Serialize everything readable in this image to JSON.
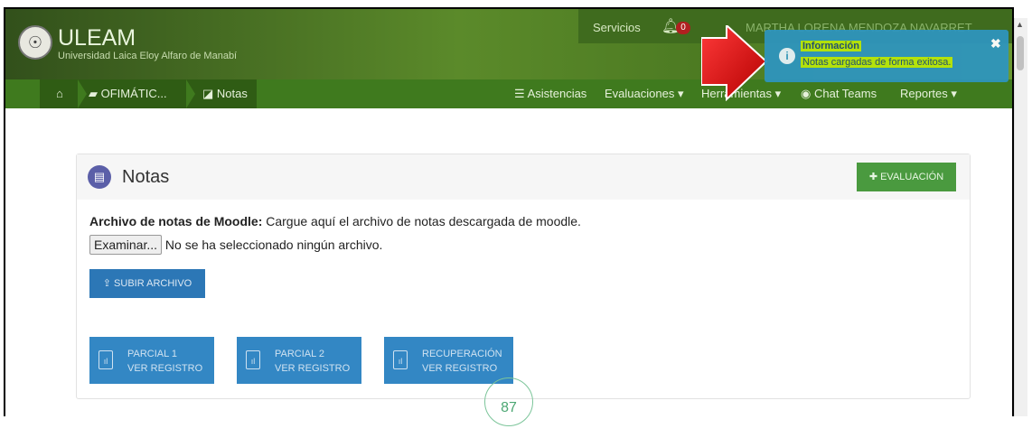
{
  "brand": {
    "title": "ULEAM",
    "subtitle": "Universidad Laica Eloy Alfaro de Manabí"
  },
  "top_bar": {
    "services": "Servicios",
    "notifications_count": "0",
    "user_name": "MARTHA LORENA MENDOZA NAVARRET"
  },
  "breadcrumb": {
    "course": "OFIMÁTIC...",
    "current": "Notas"
  },
  "nav": {
    "asistencias": "Asistencias",
    "evaluaciones": "Evaluaciones",
    "herramientas": "Herramientas",
    "chat": "Chat Teams",
    "reportes": "Reportes"
  },
  "panel": {
    "title": "Notas",
    "eval_button": "EVALUACIÓN",
    "desc_bold": "Archivo de notas de Moodle:",
    "desc_text": " Cargue aquí el archivo de notas descargada de moodle.",
    "file_button": "Examinar...",
    "file_status": "No se ha seleccionado ningún archivo.",
    "upload_button": "SUBIR ARCHIVO",
    "registers": [
      {
        "line1": "PARCIAL 1",
        "line2": "VER REGISTRO"
      },
      {
        "line1": "PARCIAL 2",
        "line2": "VER REGISTRO"
      },
      {
        "line1": "RECUPERACIÓN",
        "line2": "VER REGISTRO"
      }
    ]
  },
  "loader_value": "87",
  "toast": {
    "title": "Información",
    "message": "Notas cargadas de forma exitosa."
  },
  "colors": {
    "header_green": "#3f7a1e",
    "primary_blue": "#2c77b6",
    "toast_blue": "#2f95bd",
    "highlight": "#b9e70a",
    "eval_green": "#4a9a3f"
  }
}
